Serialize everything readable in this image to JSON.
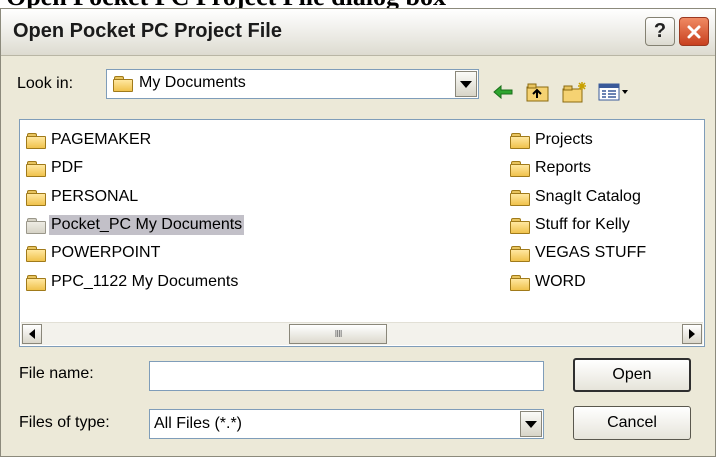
{
  "strip_text": "Open Pocket PC Project File dialog box",
  "title": "Open Pocket PC Project File",
  "help_label": "?",
  "look_in": {
    "label": "Look in:",
    "value": "My Documents"
  },
  "folders_left": [
    "PAGEMAKER",
    "PDF",
    "PERSONAL",
    "Pocket_PC My Documents",
    "POWERPOINT",
    "PPC_1122 My Documents"
  ],
  "folders_right": [
    "Projects",
    "Reports",
    "SnagIt Catalog",
    "Stuff for Kelly",
    "VEGAS STUFF",
    "WORD"
  ],
  "selected_folder": "Pocket_PC My Documents",
  "scroll_thumb_grip": "IIII",
  "file_name": {
    "label": "File name:",
    "value": ""
  },
  "file_type": {
    "label": "Files of type:",
    "value": "All Files (*.*)"
  },
  "buttons": {
    "open": "Open",
    "cancel": "Cancel"
  },
  "icons": [
    "folder-icon",
    "back-icon",
    "up-folder-icon",
    "new-folder-icon",
    "view-menu-icon",
    "close-icon",
    "help-icon"
  ],
  "colors": {
    "selection": "#c2c0c8",
    "dialog_bg": "#ece9d8",
    "close_button": "#d9532f",
    "field_border": "#7f9db9"
  }
}
